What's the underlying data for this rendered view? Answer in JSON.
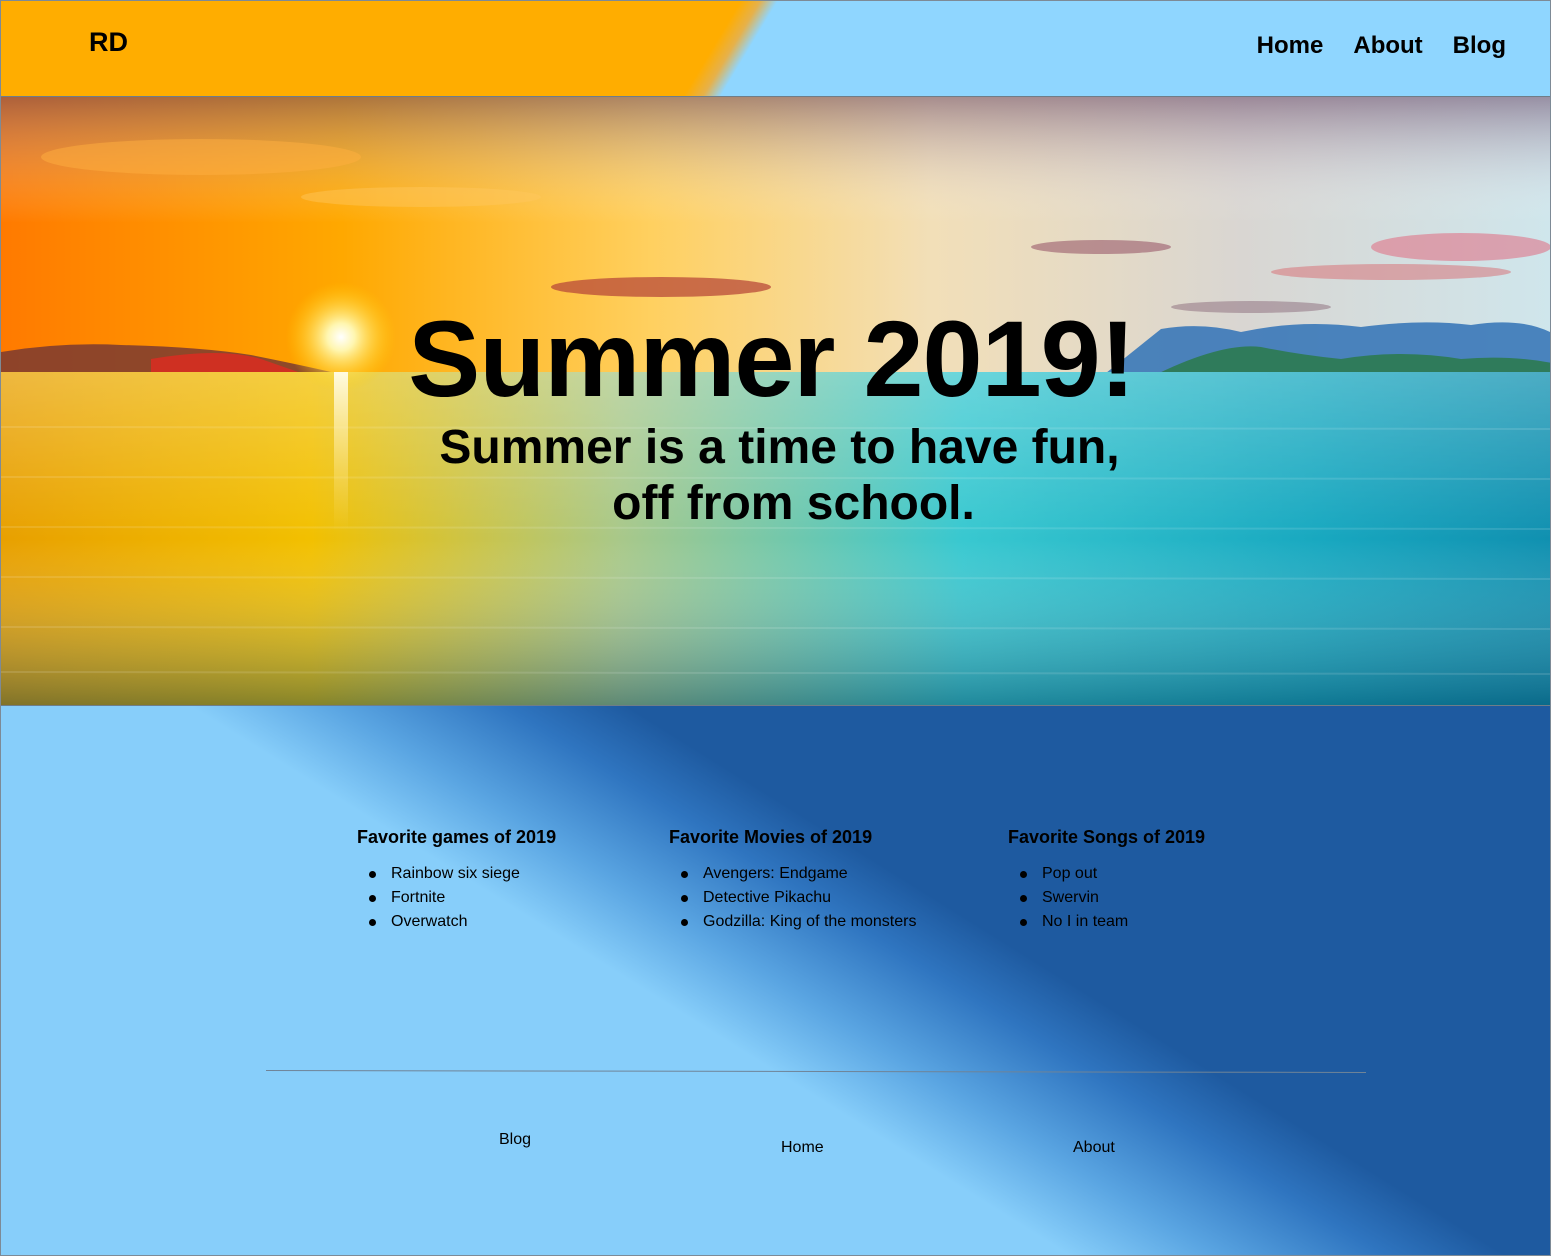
{
  "header": {
    "logo": "RD",
    "nav": [
      "Home",
      "About",
      "Blog"
    ]
  },
  "hero": {
    "title": "Summer 2019!",
    "subtitle_line1": "Summer is a time to have fun,",
    "subtitle_line2": "off from school."
  },
  "lists": {
    "games": {
      "heading": "Favorite games of 2019",
      "items": [
        "Rainbow six siege",
        "Fortnite",
        "Overwatch"
      ]
    },
    "movies": {
      "heading": "Favorite Movies of 2019",
      "items": [
        "Avengers: Endgame",
        "Detective Pikachu",
        "Godzilla: King of the monsters"
      ]
    },
    "songs": {
      "heading": "Favorite Songs of 2019",
      "items": [
        "Pop out",
        "Swervin",
        "No I in team"
      ]
    }
  },
  "footer": {
    "links": [
      "Blog",
      "Home",
      "About"
    ]
  },
  "colors": {
    "header_orange": "#ffad00",
    "header_blue": "#8fd6ff",
    "light_blue": "#87cefa",
    "dark_blue": "#1e5aa0"
  }
}
